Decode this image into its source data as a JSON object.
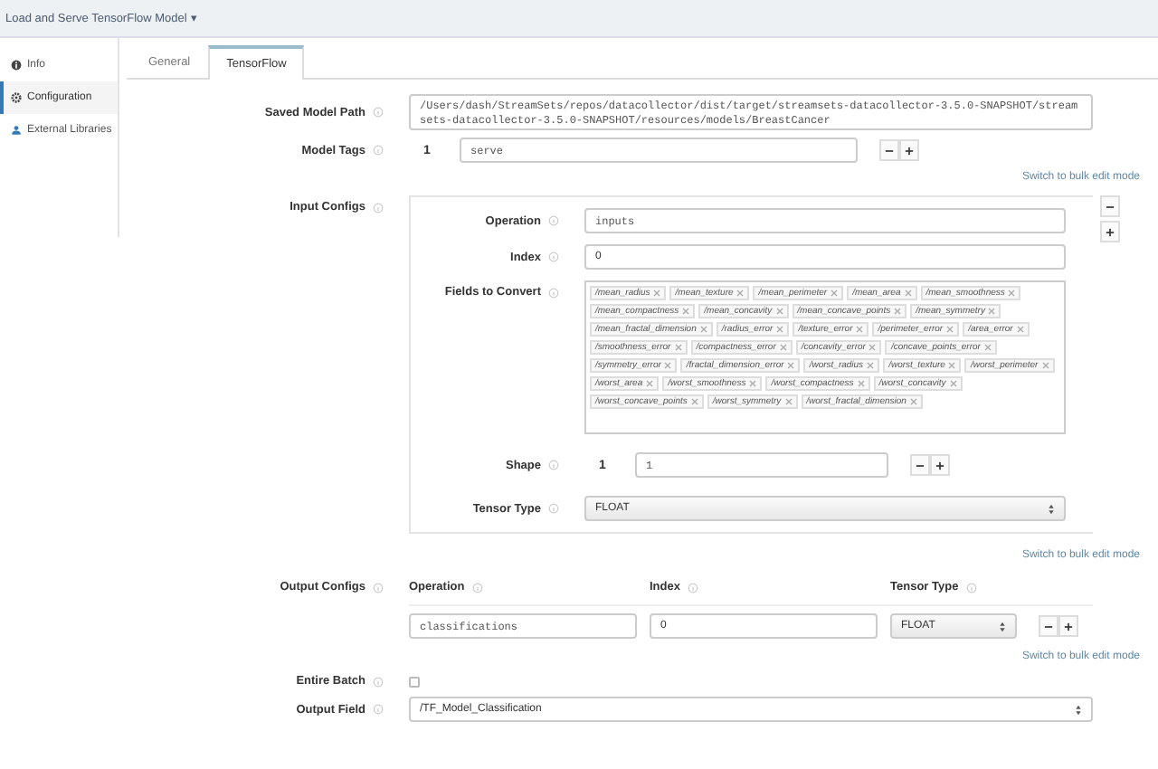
{
  "header": {
    "title": "Load and Serve TensorFlow Model",
    "caret": "▾"
  },
  "sidebar": {
    "items": [
      {
        "label": "Info",
        "kind": "info",
        "selected": false
      },
      {
        "label": "Configuration",
        "kind": "settings",
        "selected": true
      },
      {
        "label": "External Libraries",
        "kind": "libraries",
        "selected": false
      }
    ]
  },
  "tabs": [
    {
      "label": "General",
      "selected": false
    },
    {
      "label": "TensorFlow",
      "selected": true
    }
  ],
  "saved_model_path": {
    "label": "Saved Model Path",
    "value": "/Users/dash/StreamSets/repos/datacollector/dist/target/streamsets-datacollector-3.5.0-SNAPSHOT/streamsets-datacollector-3.5.0-SNAPSHOT/resources/models/BreastCancer"
  },
  "model_tags": {
    "label": "Model Tags",
    "rows": [
      {
        "index": "1",
        "value": "serve"
      }
    ],
    "bulk_link": "Switch to bulk edit mode"
  },
  "input_configs": {
    "label": "Input Configs",
    "operation": {
      "label": "Operation",
      "value": "inputs"
    },
    "index": {
      "label": "Index",
      "value": "0"
    },
    "fields_to_convert": {
      "label": "Fields to Convert",
      "tags": [
        "/mean_radius",
        "/mean_texture",
        "/mean_perimeter",
        "/mean_area",
        "/mean_smoothness",
        "/mean_compactness",
        "/mean_concavity",
        "/mean_concave_points",
        "/mean_symmetry",
        "/mean_fractal_dimension",
        "/radius_error",
        "/texture_error",
        "/perimeter_error",
        "/area_error",
        "/smoothness_error",
        "/compactness_error",
        "/concavity_error",
        "/concave_points_error",
        "/symmetry_error",
        "/fractal_dimension_error",
        "/worst_radius",
        "/worst_texture",
        "/worst_perimeter",
        "/worst_area",
        "/worst_smoothness",
        "/worst_compactness",
        "/worst_concavity",
        "/worst_concave_points",
        "/worst_symmetry",
        "/worst_fractal_dimension"
      ]
    },
    "shape": {
      "label": "Shape",
      "rows": [
        {
          "index": "1",
          "value": "1"
        }
      ]
    },
    "tensor_type": {
      "label": "Tensor Type",
      "value": "FLOAT"
    },
    "bulk_link": "Switch to bulk edit mode"
  },
  "output_configs": {
    "label": "Output Configs",
    "columns": [
      "Operation",
      "Index",
      "Tensor Type"
    ],
    "rows": [
      {
        "operation": "classifications",
        "index": "0",
        "tensor_type": "FLOAT"
      }
    ],
    "bulk_link": "Switch to bulk edit mode"
  },
  "entire_batch": {
    "label": "Entire Batch",
    "checked": false
  },
  "output_field": {
    "label": "Output Field",
    "value": "/TF_Model_Classification"
  }
}
